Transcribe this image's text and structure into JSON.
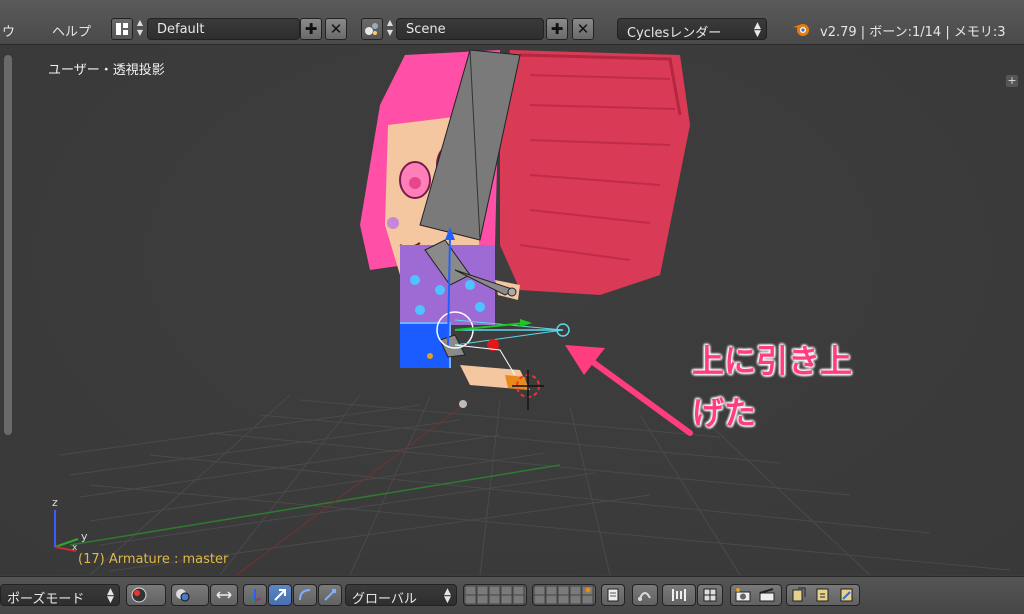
{
  "topbar": {
    "menu_truncated": "ウ",
    "menu_help": "ヘルプ",
    "layout_name": "Default",
    "scene_name": "Scene",
    "render_engine": "Cyclesレンダー",
    "stats": "v2.79 | ボーン:1/14  | メモリ:3"
  },
  "viewport": {
    "view_label": "ユーザー・透視投影",
    "status": "(17) Armature : master",
    "axis_x": "x",
    "axis_y": "y",
    "axis_z": "z",
    "annotation_line1": "上に引き上",
    "annotation_line2": "げた",
    "annotation_color": "#ff3d7f"
  },
  "bottombar": {
    "mode": "ポーズモード",
    "orientation": "グローバル"
  },
  "colors": {
    "header_bg": "#4a4a4a",
    "viewport_bg": "#393939",
    "accent_blue": "#5680c2",
    "status_text": "#e0b84a"
  }
}
